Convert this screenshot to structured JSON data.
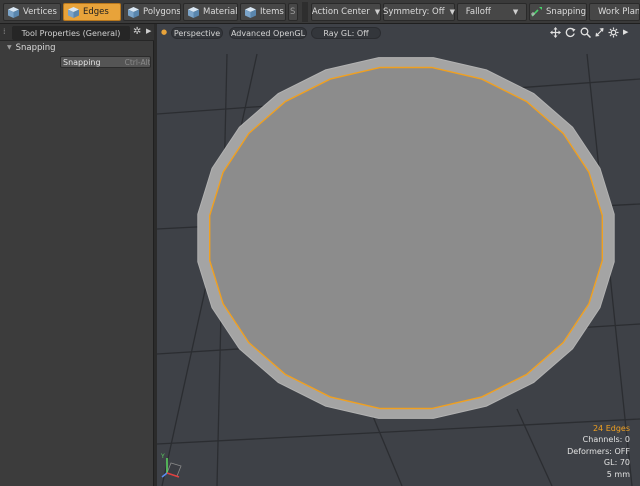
{
  "toolbar": {
    "modes": [
      {
        "label": "Vertices",
        "active": false
      },
      {
        "label": "Edges",
        "active": true
      },
      {
        "label": "Polygons",
        "active": false
      },
      {
        "label": "Materials",
        "active": false
      },
      {
        "label": "Items",
        "active": false
      },
      {
        "label": "S",
        "active": false
      }
    ],
    "action_center": "Action Center",
    "symmetry": "Symmetry: Off",
    "falloff": "Falloff",
    "snapping": "Snapping",
    "work_plane": "Work Plane"
  },
  "left_panel": {
    "tab_title": "Tool Properties (General)",
    "section_title": "Snapping",
    "snapping_button": "Snapping",
    "snapping_shortcut": "Ctrl-Alt-J"
  },
  "viewport": {
    "view_label": "Perspective",
    "render_label": "Advanced OpenGL",
    "raygl_label": "Ray GL: Off",
    "stats": {
      "edges": "24 Edges",
      "channels": "Channels: 0",
      "deformers": "Deformers: OFF",
      "gl": "GL: 70",
      "scale": "5 mm"
    },
    "colors": {
      "background": "#3e4147",
      "grid": "#2b2d31",
      "disc_fill": "#8c8c8c",
      "disc_rim": "#a4a4a4",
      "selected_edge": "#f0a020",
      "accent": "#e8a33a"
    }
  }
}
